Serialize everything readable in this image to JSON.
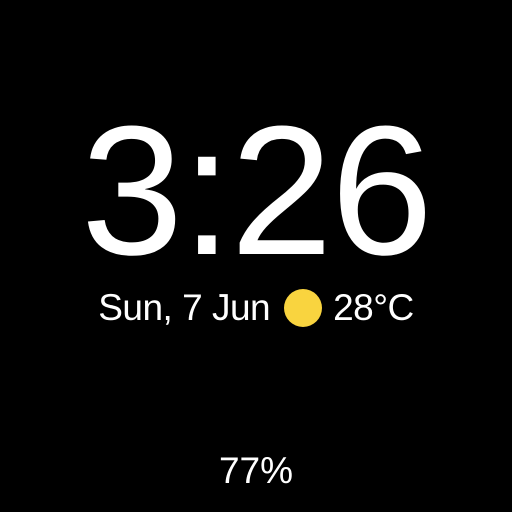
{
  "watchface": {
    "time": "3:26",
    "date": "Sun, 7 Jun",
    "weather": {
      "icon": "sun-icon",
      "temperature": "28°C"
    },
    "battery": "77%"
  },
  "colors": {
    "background": "#000000",
    "text": "#ffffff",
    "sun": "#f9d43f"
  }
}
